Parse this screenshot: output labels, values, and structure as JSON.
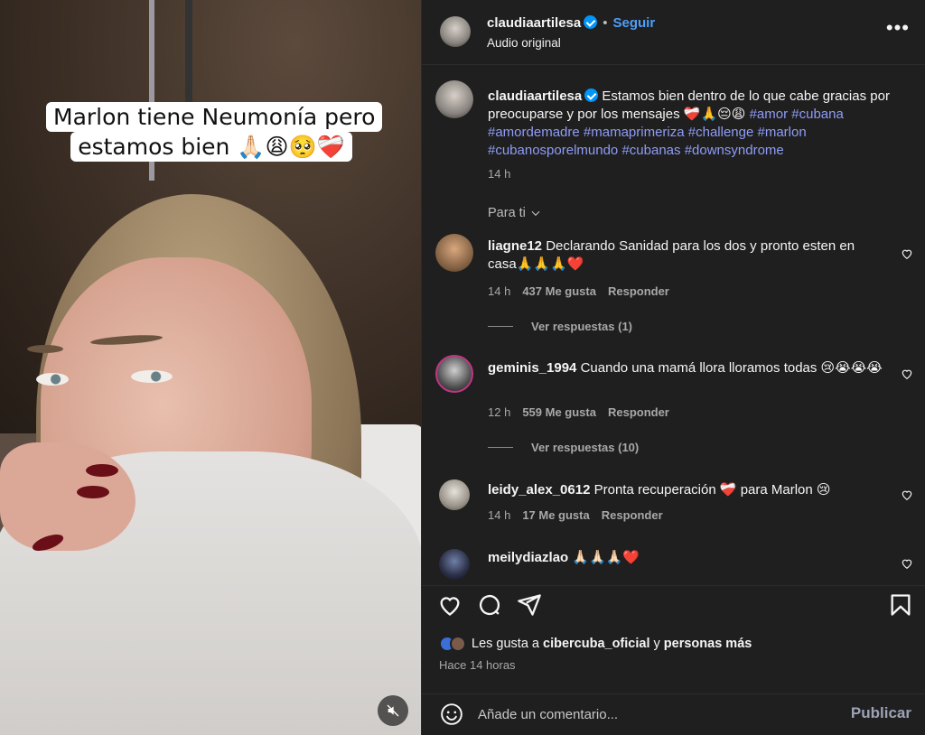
{
  "video": {
    "caption": "Marlon tiene Neumonía pero estamos bien 🙏🏻😩🥺❤️‍🩹"
  },
  "header": {
    "username": "claudiaartilesa",
    "separator": "•",
    "follow": "Seguir",
    "audio": "Audio original",
    "more": "•••"
  },
  "post": {
    "username": "claudiaartilesa",
    "text": "Estamos bien dentro de lo que cabe gracias por preocuparse y por los mensajes ❤️‍🩹🙏😔😩",
    "hashtags": [
      "#amor",
      "#cubana",
      "#amordemadre",
      "#mamaprimeriza",
      "#challenge",
      "#marlon",
      "#cubanosporelmundo",
      "#cubanas",
      "#downsyndrome"
    ],
    "time": "14 h"
  },
  "filter": {
    "label": "Para ti"
  },
  "comments": [
    {
      "username": "liagne12",
      "text": "Declarando Sanidad para los dos y pronto esten en casa🙏🙏🙏❤️",
      "time": "14 h",
      "likes": "437 Me gusta",
      "reply": "Responder",
      "view_replies": "Ver respuestas (1)"
    },
    {
      "username": "geminis_1994",
      "text": "Cuando una mamá llora lloramos todas 😢😭😭😭",
      "time": "12 h",
      "likes": "559 Me gusta",
      "reply": "Responder",
      "view_replies": "Ver respuestas (10)"
    },
    {
      "username": "leidy_alex_0612",
      "text": "Pronta recuperación ❤️‍🩹 para Marlon 😢",
      "time": "14 h",
      "likes": "17 Me gusta",
      "reply": "Responder"
    },
    {
      "username": "meilydiazlao",
      "text": "🙏🏻🙏🏻🙏🏻❤️"
    }
  ],
  "likes": {
    "prefix": "Les gusta a",
    "user": "cibercuba_oficial",
    "conj": "y",
    "others": "personas más"
  },
  "timestamp": "Hace 14 horas",
  "add_comment": {
    "placeholder": "Añade un comentario...",
    "publish": "Publicar"
  },
  "colors": {
    "panel_bg": "#1f1f1f",
    "link_blue": "#4d9ffb",
    "hashtag": "#8f9cf6",
    "verified": "#0095f6"
  },
  "icons": [
    "heart-icon",
    "comment-icon",
    "share-icon",
    "bookmark-icon",
    "emoji-icon",
    "mute-icon",
    "verified-icon",
    "more-icon",
    "chevron-down-icon"
  ]
}
